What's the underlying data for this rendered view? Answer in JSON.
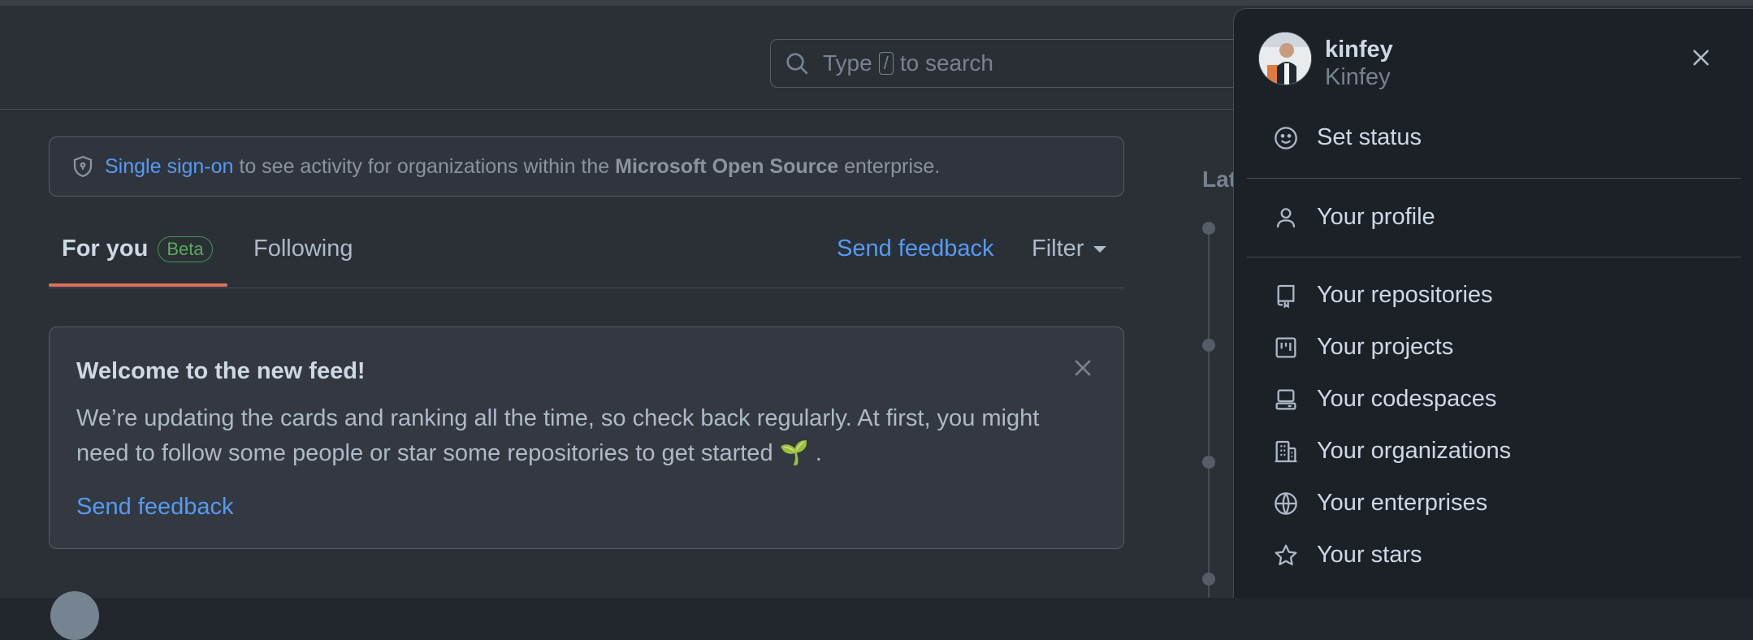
{
  "search": {
    "prefix": "Type",
    "key": "/",
    "suffix": "to search"
  },
  "sso_banner": {
    "link": "Single sign-on",
    "text_before_org": " to see activity for organizations within the ",
    "org": "Microsoft Open Source",
    "text_after_org": " enterprise."
  },
  "feed_tabs": {
    "for_you": "For you",
    "beta": "Beta",
    "following": "Following",
    "send_feedback": "Send feedback",
    "filter": "Filter"
  },
  "welcome_card": {
    "title": "Welcome to the new feed!",
    "body": "We’re updating the cards and ranking all the time, so check back regularly. At first, you might need to follow some people or star some repositories to get started 🌱 .",
    "feedback": "Send feedback"
  },
  "right_column": {
    "heading_partial": "Lat"
  },
  "user_menu": {
    "login": "kinfey",
    "name": "Kinfey",
    "items": [
      {
        "label": "Set status",
        "icon": "smiley-icon"
      },
      {
        "label": "Your profile",
        "icon": "person-icon"
      },
      {
        "label": "Your repositories",
        "icon": "repo-icon"
      },
      {
        "label": "Your projects",
        "icon": "project-icon"
      },
      {
        "label": "Your codespaces",
        "icon": "codespaces-icon"
      },
      {
        "label": "Your organizations",
        "icon": "organization-icon"
      },
      {
        "label": "Your enterprises",
        "icon": "globe-icon"
      },
      {
        "label": "Your stars",
        "icon": "star-icon"
      }
    ]
  },
  "colors": {
    "background": "#22272e",
    "link": "#539bf5",
    "tab_underline": "#e0715b",
    "beta": "#57ab5a",
    "panel": "#1c2128"
  }
}
